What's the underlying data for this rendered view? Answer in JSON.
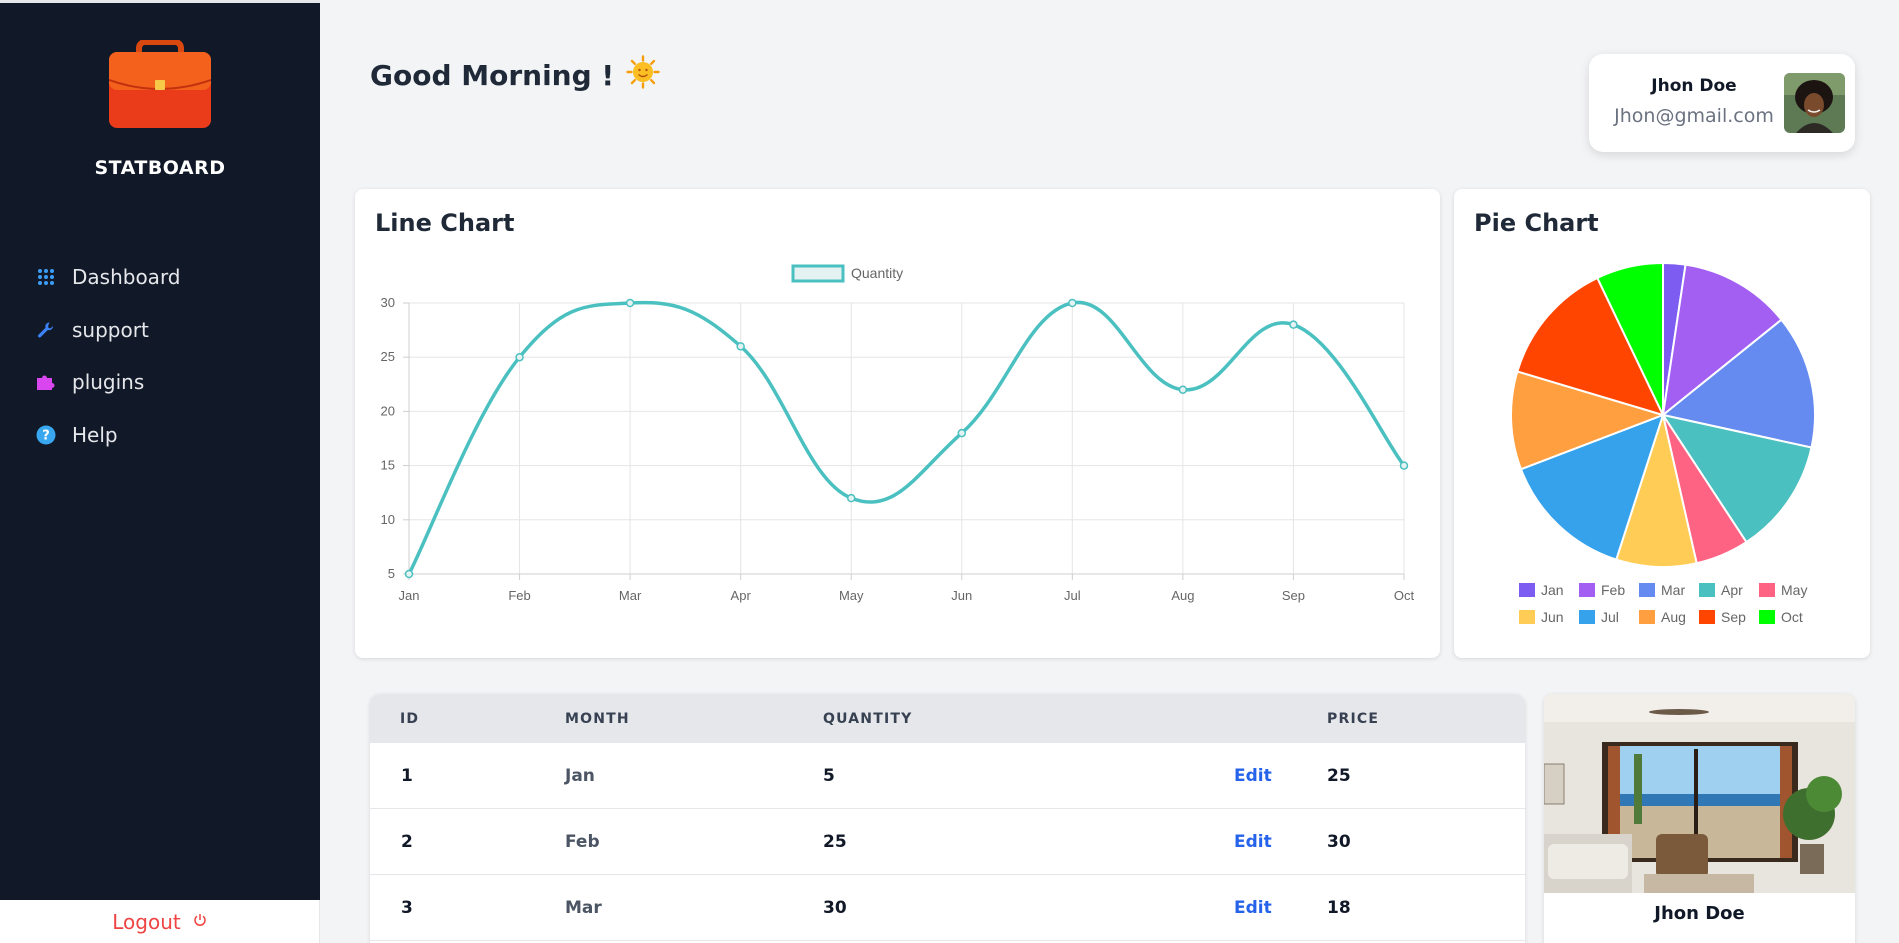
{
  "app": {
    "name": "STATBOARD"
  },
  "sidebar": {
    "items": [
      {
        "label": "Dashboard",
        "icon": "grid-icon"
      },
      {
        "label": "support",
        "icon": "wrench-icon"
      },
      {
        "label": "plugins",
        "icon": "puzzle-icon"
      },
      {
        "label": "Help",
        "icon": "help-icon"
      }
    ],
    "logout_label": "Logout"
  },
  "header": {
    "greeting": "Good Morning !"
  },
  "user": {
    "name": "Jhon Doe",
    "email": "Jhon@gmail.com"
  },
  "line_card": {
    "title": "Line Chart"
  },
  "pie_card": {
    "title": "Pie Chart"
  },
  "colors": {
    "line": "#4bc0c0",
    "pie": [
      "#7c5cf1",
      "#a25ff2",
      "#658bf0",
      "#4bc0c0",
      "#ff6384",
      "#ffcd56",
      "#36a2eb",
      "#ff9f40",
      "#ff4500",
      "#00ff00"
    ],
    "sidebar_bg": "#111827",
    "edit_link": "#2563eb",
    "logout": "#ef4444"
  },
  "chart_data": [
    {
      "type": "line",
      "x": [
        "Jan",
        "Feb",
        "Mar",
        "Apr",
        "May",
        "Jun",
        "Jul",
        "Aug",
        "Sep",
        "Oct"
      ],
      "series": [
        {
          "name": "Quantity",
          "values": [
            5,
            25,
            30,
            26,
            12,
            18,
            30,
            22,
            28,
            15
          ]
        }
      ],
      "yticks": [
        5,
        10,
        15,
        20,
        25,
        30
      ],
      "ylim": [
        5,
        30
      ],
      "grid": true,
      "legend": "top-center"
    },
    {
      "type": "pie",
      "categories": [
        "Jan",
        "Feb",
        "Mar",
        "Apr",
        "May",
        "Jun",
        "Jul",
        "Aug",
        "Sep",
        "Oct"
      ],
      "values": [
        5,
        25,
        30,
        26,
        12,
        18,
        30,
        22,
        28,
        15
      ],
      "legend": "bottom"
    }
  ],
  "table": {
    "headers": [
      "ID",
      "MONTH",
      "QUANTITY",
      "PRICE"
    ],
    "edit_label": "Edit",
    "rows": [
      {
        "id": "1",
        "month": "Jan",
        "quantity": "5",
        "price": "25"
      },
      {
        "id": "2",
        "month": "Feb",
        "quantity": "25",
        "price": "30"
      },
      {
        "id": "3",
        "month": "Mar",
        "quantity": "30",
        "price": "18"
      }
    ]
  },
  "property": {
    "name": "Jhon Doe"
  }
}
